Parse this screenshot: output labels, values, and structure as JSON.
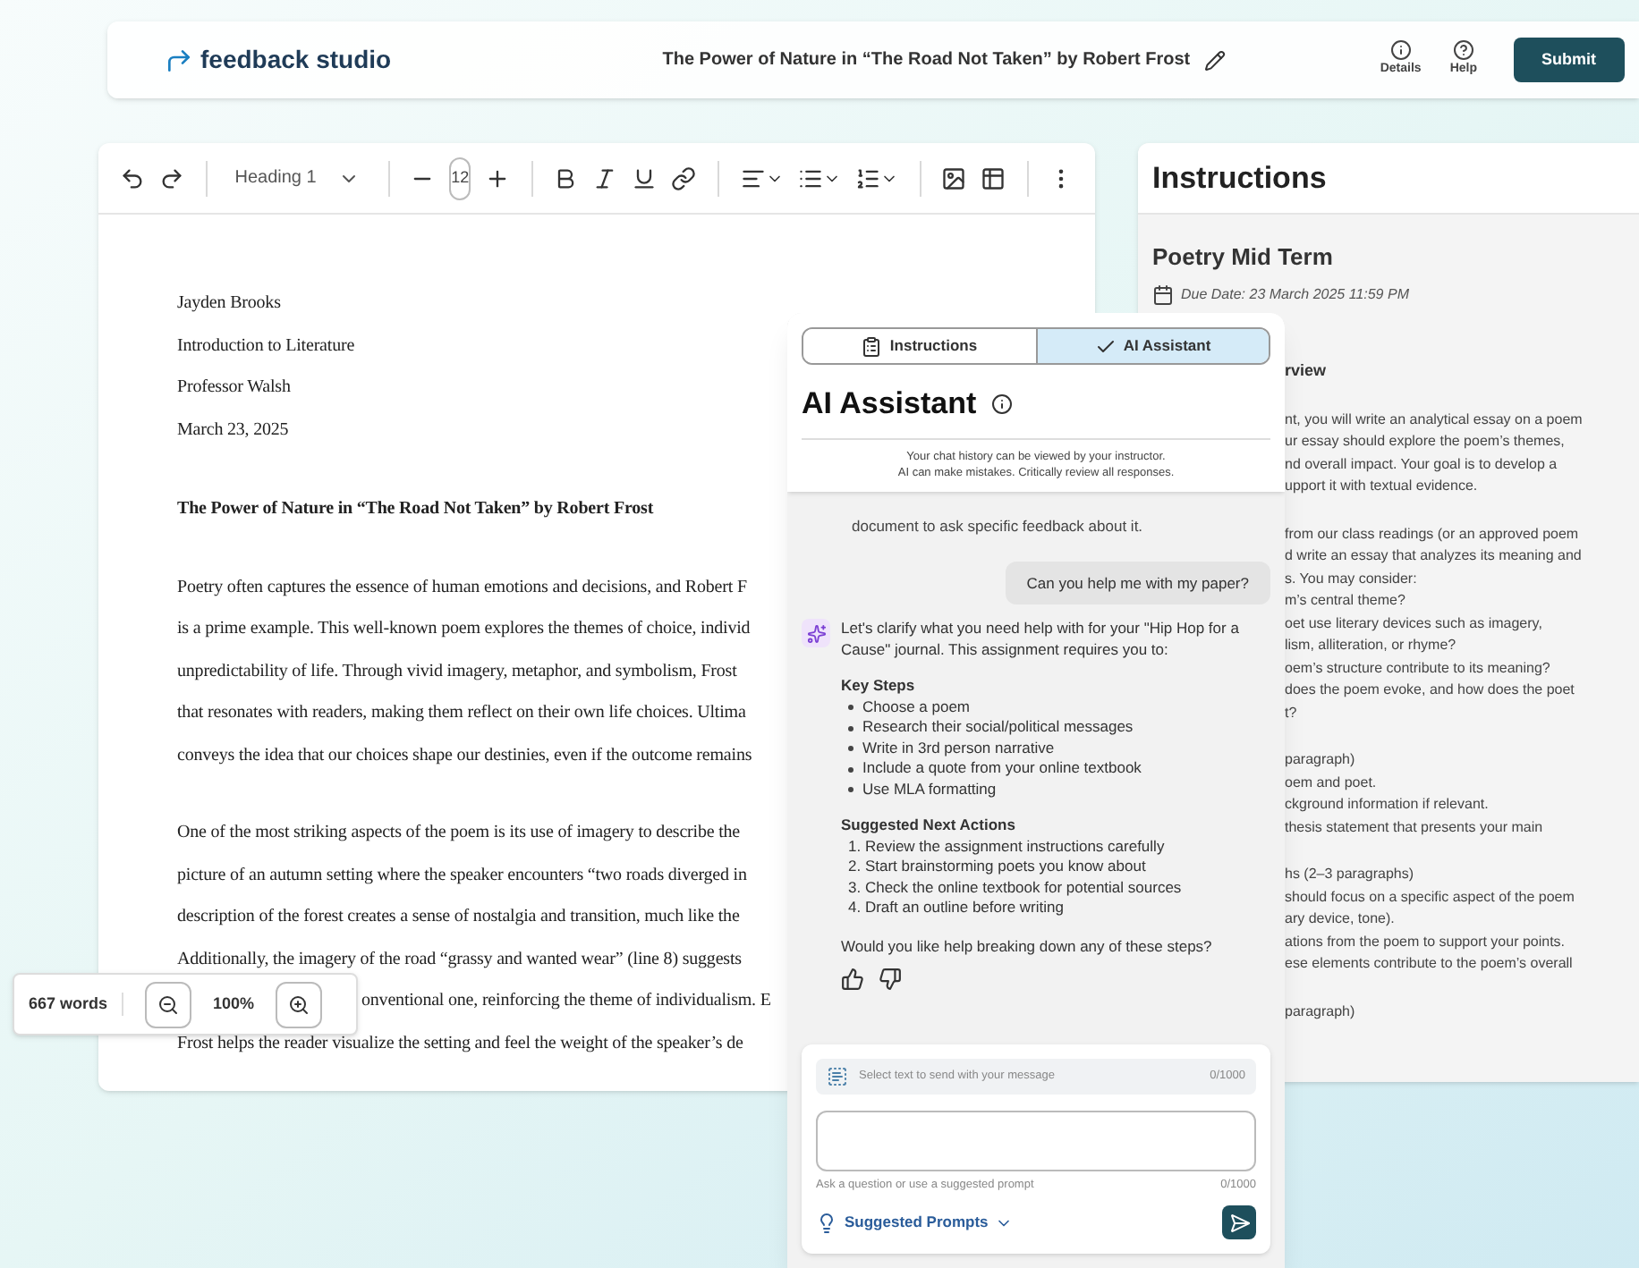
{
  "header": {
    "logo": "feedback studio",
    "title": "The Power of Nature in “The Road Not Taken” by Robert Frost",
    "actions": [
      {
        "kind": "details",
        "label": "Details"
      },
      {
        "kind": "help",
        "label": "Help"
      }
    ],
    "submit": "Submit"
  },
  "toolbar": {
    "style": "Heading 1",
    "font_size": "12"
  },
  "document": {
    "heading_lines": [
      "Jayden Brooks",
      "Introduction to Literature",
      "Professor Walsh",
      "March 23, 2025"
    ],
    "title": "The Power of Nature in “The Road Not Taken” by Robert Frost",
    "paragraphs": [
      [
        {
          "kind": "line",
          "text": "Poetry often captures the essence of human emotions and decisions, and Robert F"
        },
        {
          "kind": "line",
          "text": "is a prime example. This well-known poem explores the themes of choice, individ"
        },
        {
          "kind": "line",
          "text": "unpredictability of life. Through vivid imagery, metaphor, and symbolism, Frost"
        },
        {
          "kind": "line",
          "text": "that resonates with readers, making them reflect on their own life choices. Ultima"
        },
        {
          "kind": "line",
          "text": "conveys the idea that our choices shape our destinies, even if the outcome remains"
        }
      ],
      [
        {
          "kind": "line",
          "text": "One of the most striking aspects of the poem is its use of imagery to describe the"
        },
        {
          "kind": "line",
          "text": "picture of an autumn setting where the speaker encounters “two roads diverged in"
        },
        {
          "kind": "line",
          "text": "description of the forest creates a sense of nostalgia and transition, much like the"
        },
        {
          "kind": "line",
          "text": "Additionally, the imagery of the road “grassy and wanted wear” (line 8) suggests"
        },
        {
          "kind": "covered",
          "text": "onventional one, reinforcing the theme of individualism. E"
        },
        {
          "kind": "line",
          "text": "Frost helps the reader visualize the setting and feel the weight of the speaker’s de"
        }
      ]
    ]
  },
  "word_count": {
    "words": "667 words",
    "zoom": "100%"
  },
  "instructions": {
    "title": "Instructions",
    "assignment": "Poetry Mid Term",
    "due_date": "Due Date: 23 March 2025 11:59 PM",
    "section_heading": "rview",
    "paragraphs": [
      [
        "nt, you will write an analytical essay on a poem",
        "ur essay should explore the poem’s themes,",
        "nd overall impact. Your goal is to develop a",
        "upport it with textual evidence."
      ],
      [
        "from our class readings (or an approved poem",
        "d write an essay that analyzes its meaning and",
        "s. You may consider:",
        "m’s central theme?",
        "oet use literary devices such as imagery,",
        "lism, alliteration, or rhyme?",
        "oem’s structure contribute to its meaning?",
        "does the poem evoke, and how does the poet",
        "t?"
      ],
      [
        "paragraph)",
        "oem and poet.",
        "ckground information if relevant.",
        "thesis statement that presents your main"
      ],
      [
        "hs (2–3 paragraphs)",
        "should focus on a specific aspect of the poem",
        "ary device, tone).",
        "ations from the poem to support your points.",
        "ese elements contribute to the poem’s overall"
      ],
      [
        "paragraph)"
      ]
    ]
  },
  "ai_panel": {
    "tabs": [
      {
        "label": "Instructions",
        "selected": false
      },
      {
        "label": "AI Assistant",
        "selected": true
      }
    ],
    "title": "AI Assistant",
    "notice": [
      "Your chat history can be viewed by your instructor.",
      "AI can make mistakes. Critically review all responses."
    ],
    "messages": [
      {
        "kind": "hint",
        "text": "document to ask specific feedback about it."
      },
      {
        "kind": "user",
        "text": "Can you help me with my paper?"
      },
      {
        "kind": "assistant",
        "text": "Let's clarify what you need help with for your \"Hip Hop for a Cause\" journal. This assignment requires you to:",
        "sections": [
          {
            "kind": "bullets",
            "heading": "Key Steps",
            "items": [
              "Choose a poem",
              "Research their social/political messages",
              "Write in 3rd person narrative",
              "Include a quote from your online textbook",
              "Use MLA formatting"
            ]
          },
          {
            "kind": "numbered",
            "heading": "Suggested Next Actions",
            "items": [
              "1. Review the assignment instructions carefully",
              "2. Start brainstorming poets you know about",
              "3. Check the online textbook for potential sources",
              "4. Draft an outline before writing"
            ]
          }
        ],
        "question": "Would you like help breaking down any of these steps?"
      }
    ],
    "composer": {
      "selection_hint": "Select text to send with your message",
      "selection_count": "0/1000",
      "helper": "Ask a question or use a suggested prompt",
      "count": "0/1000",
      "prompts": "Suggested Prompts"
    }
  }
}
